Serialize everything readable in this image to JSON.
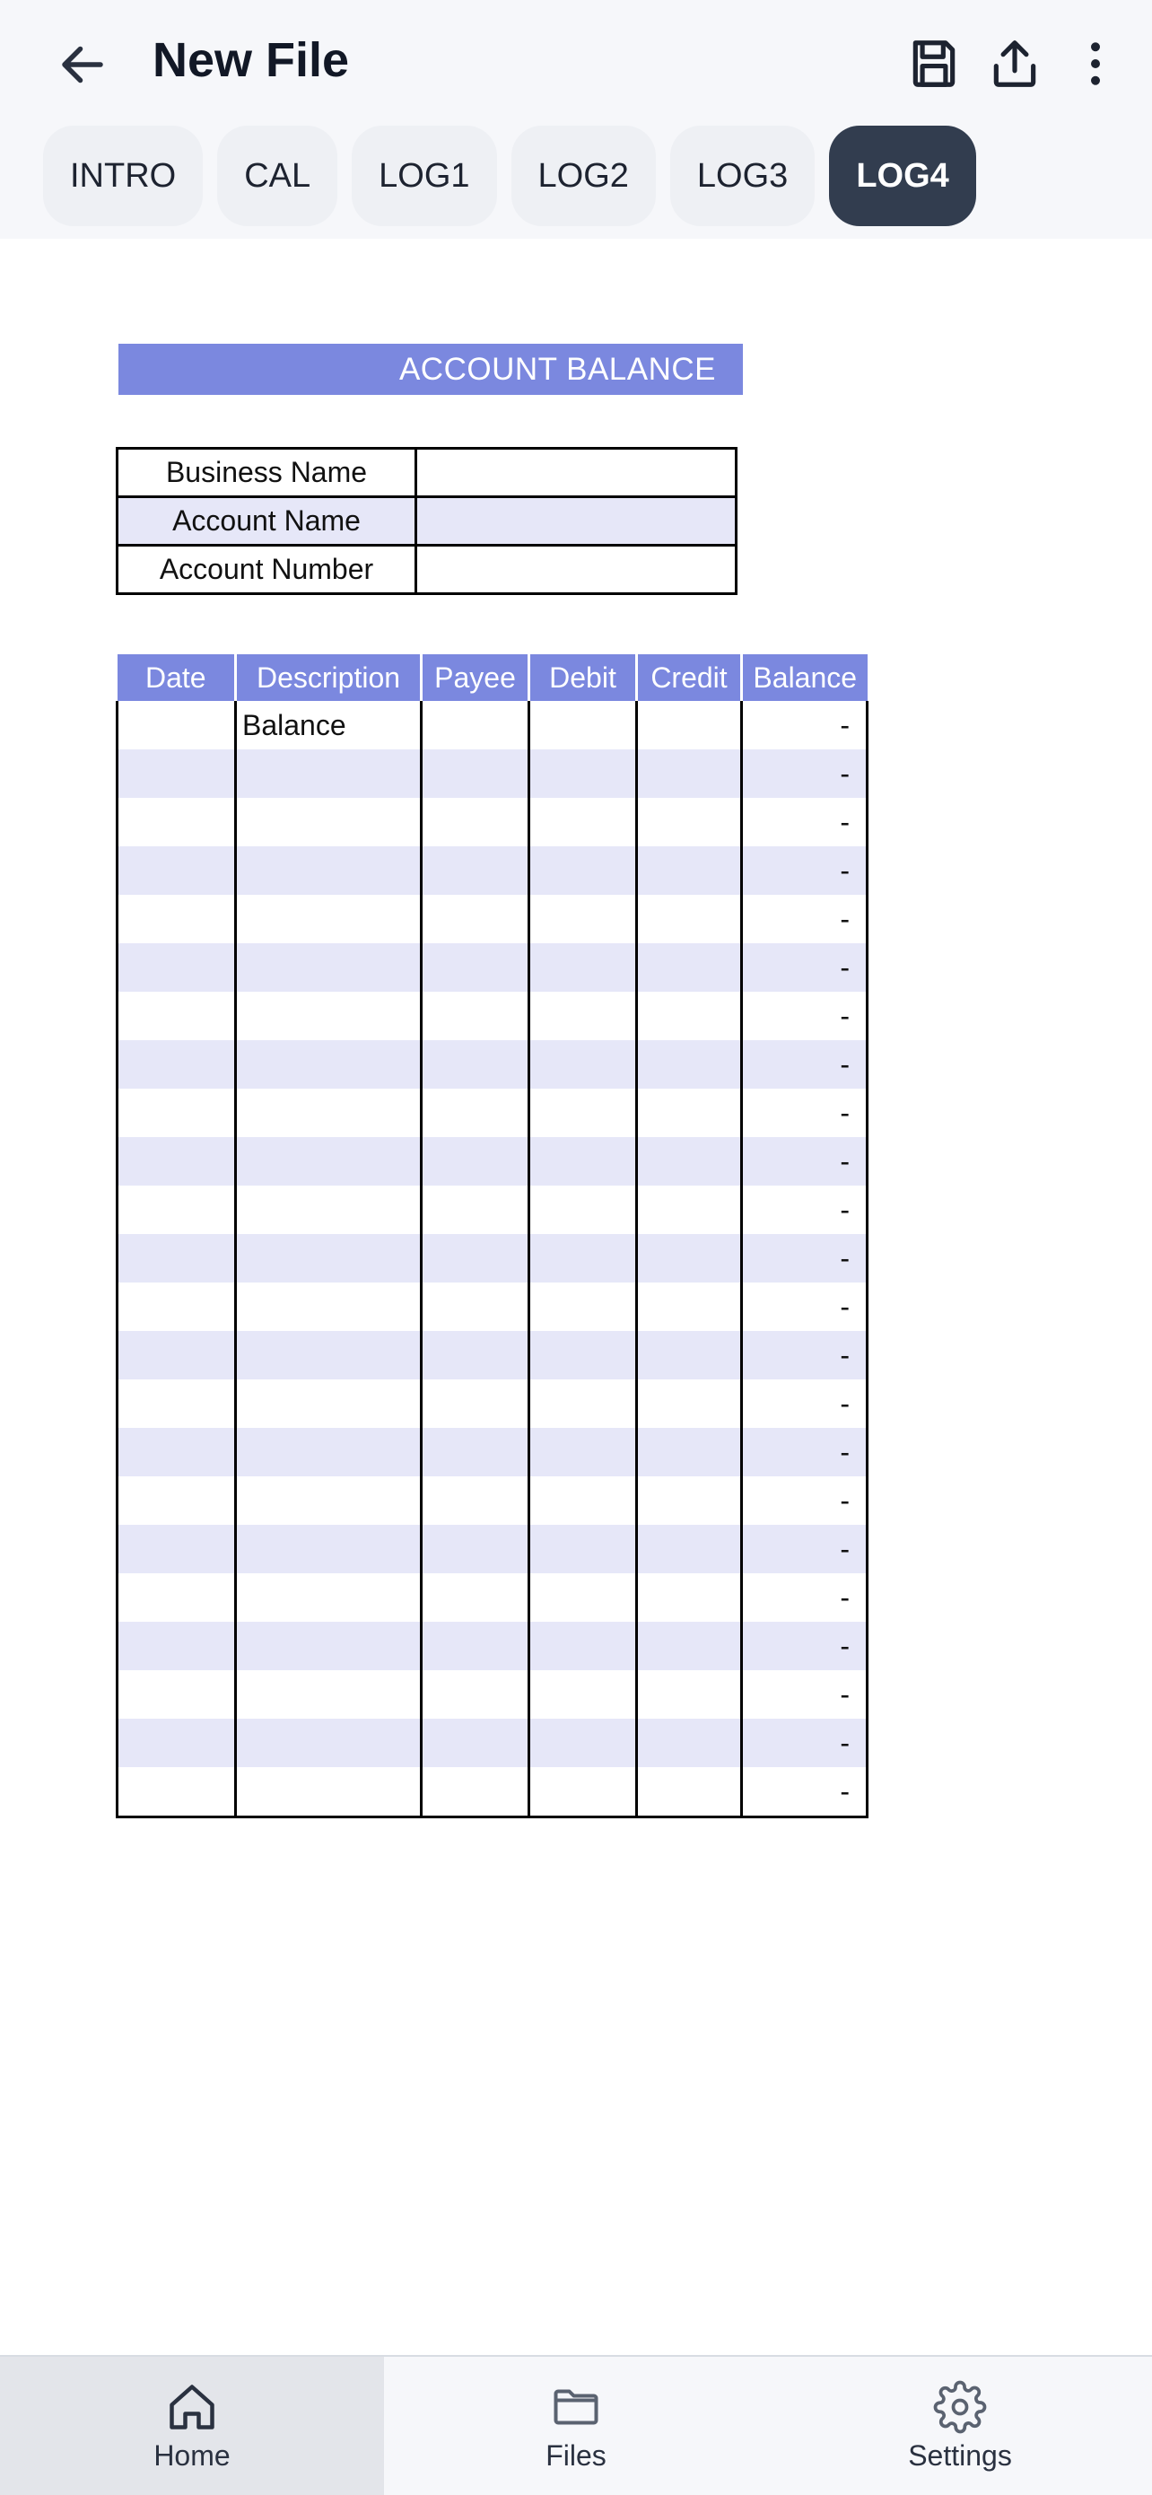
{
  "header": {
    "title": "New File",
    "icons": {
      "back": "arrow-left-icon",
      "save": "floppy-disk-icon",
      "share": "share-upload-icon",
      "more": "more-vertical-icon"
    }
  },
  "tabs": [
    {
      "label": "INTRO",
      "active": false
    },
    {
      "label": "CAL",
      "active": false
    },
    {
      "label": "LOG1",
      "active": false
    },
    {
      "label": "LOG2",
      "active": false
    },
    {
      "label": "LOG3",
      "active": false
    },
    {
      "label": "LOG4",
      "active": true
    }
  ],
  "sheet": {
    "title": "ACCOUNT BALANCE",
    "info_rows": [
      {
        "label": "Business Name",
        "value": ""
      },
      {
        "label": "Account Name",
        "value": ""
      },
      {
        "label": "Account Number",
        "value": ""
      }
    ],
    "columns": [
      "Date",
      "Description",
      "Payee",
      "Debit",
      "Credit",
      "Balance"
    ],
    "rows": [
      [
        "",
        "Balance",
        "",
        "",
        "",
        "-"
      ],
      [
        "",
        "",
        "",
        "",
        "",
        "-"
      ],
      [
        "",
        "",
        "",
        "",
        "",
        "-"
      ],
      [
        "",
        "",
        "",
        "",
        "",
        "-"
      ],
      [
        "",
        "",
        "",
        "",
        "",
        "-"
      ],
      [
        "",
        "",
        "",
        "",
        "",
        "-"
      ],
      [
        "",
        "",
        "",
        "",
        "",
        "-"
      ],
      [
        "",
        "",
        "",
        "",
        "",
        "-"
      ],
      [
        "",
        "",
        "",
        "",
        "",
        "-"
      ],
      [
        "",
        "",
        "",
        "",
        "",
        "-"
      ],
      [
        "",
        "",
        "",
        "",
        "",
        "-"
      ],
      [
        "",
        "",
        "",
        "",
        "",
        "-"
      ],
      [
        "",
        "",
        "",
        "",
        "",
        "-"
      ],
      [
        "",
        "",
        "",
        "",
        "",
        "-"
      ],
      [
        "",
        "",
        "",
        "",
        "",
        "-"
      ],
      [
        "",
        "",
        "",
        "",
        "",
        "-"
      ],
      [
        "",
        "",
        "",
        "",
        "",
        "-"
      ],
      [
        "",
        "",
        "",
        "",
        "",
        "-"
      ],
      [
        "",
        "",
        "",
        "",
        "",
        "-"
      ],
      [
        "",
        "",
        "",
        "",
        "",
        "-"
      ],
      [
        "",
        "",
        "",
        "",
        "",
        "-"
      ],
      [
        "",
        "",
        "",
        "",
        "",
        "-"
      ],
      [
        "",
        "",
        "",
        "",
        "",
        "-"
      ]
    ]
  },
  "bottom_nav": [
    {
      "label": "Home",
      "icon": "home-icon",
      "active": true
    },
    {
      "label": "Files",
      "icon": "folder-icon",
      "active": false
    },
    {
      "label": "Settings",
      "icon": "gear-icon",
      "active": false
    }
  ],
  "colors": {
    "accent": "#7b88df",
    "row_shade": "#e6e7f8",
    "active_tab": "#323d4f",
    "appbar_bg": "#f6f7fa"
  }
}
